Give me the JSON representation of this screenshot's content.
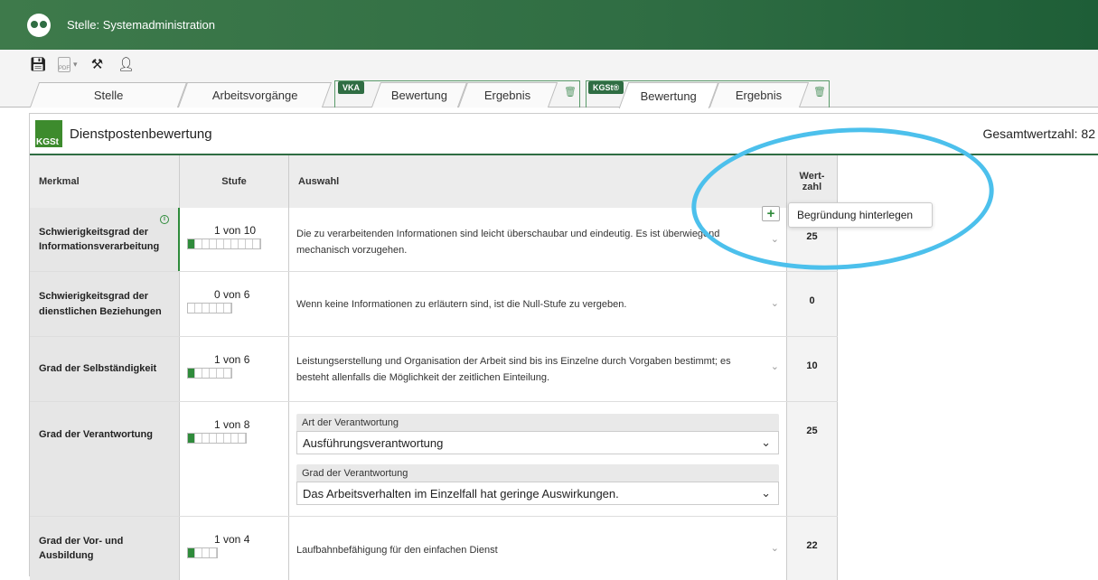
{
  "window": {
    "title": "Stelle: Systemadministration"
  },
  "toolbar": {
    "pdf_label": "PDF"
  },
  "tabs": {
    "stelle": "Stelle",
    "arbeitsvorgaenge": "Arbeitsvorgänge",
    "vka_tag": "VKA",
    "vka_bewertung": "Bewertung",
    "vka_ergebnis": "Ergebnis",
    "kgst_tag": "KGSt®",
    "kgst_bewertung": "Bewertung",
    "kgst_ergebnis": "Ergebnis"
  },
  "panel": {
    "logo_text": "KGSt",
    "title": "Dienstpostenbewertung",
    "total": "Gesamtwertzahl: 82"
  },
  "table": {
    "headers": {
      "merkmal": "Merkmal",
      "stufe": "Stufe",
      "auswahl": "Auswahl",
      "wertzahl": "Wert-zahl"
    },
    "rows": [
      {
        "merkmal": "Schwierigkeitsgrad der Informationsverarbeitung",
        "stufe": "1 von 10",
        "level": 1,
        "max": 10,
        "auswahl": "Die zu verarbeitenden Informationen sind leicht überschaubar und eindeutig. Es ist überwiegend mechanisch vorzugehen.",
        "wertzahl": "25"
      },
      {
        "merkmal": "Schwierigkeitsgrad der dienstlichen Beziehungen",
        "stufe": "0 von 6",
        "level": 0,
        "max": 6,
        "auswahl": "Wenn keine Informationen zu erläutern sind, ist die Null-Stufe zu vergeben.",
        "wertzahl": "0"
      },
      {
        "merkmal": "Grad der Selbständigkeit",
        "stufe": "1 von 6",
        "level": 1,
        "max": 6,
        "auswahl": "Leistungserstellung und Organisation der Arbeit sind bis ins Einzelne durch Vorgaben bestimmt; es besteht allenfalls die Möglichkeit der zeitlichen Einteilung.",
        "wertzahl": "10"
      },
      {
        "merkmal": "Grad der Verantwortung",
        "stufe": "1 von 8",
        "level": 1,
        "max": 8,
        "wertzahl": "25",
        "select1_label": "Art der Verantwortung",
        "select1_value": "Ausführungsverantwortung",
        "select2_label": "Grad der Verantwortung",
        "select2_value": "Das Arbeitsverhalten im Einzelfall hat geringe Auswirkungen."
      },
      {
        "merkmal": "Grad der Vor- und Ausbildung",
        "stufe": "1 von 4",
        "level": 1,
        "max": 4,
        "auswahl": "Laufbahnbefähigung für den einfachen Dienst",
        "wertzahl": "22"
      }
    ]
  },
  "tooltip": {
    "text": "Begründung hinterlegen"
  },
  "annotation": {
    "color": "#4cc0ec"
  }
}
